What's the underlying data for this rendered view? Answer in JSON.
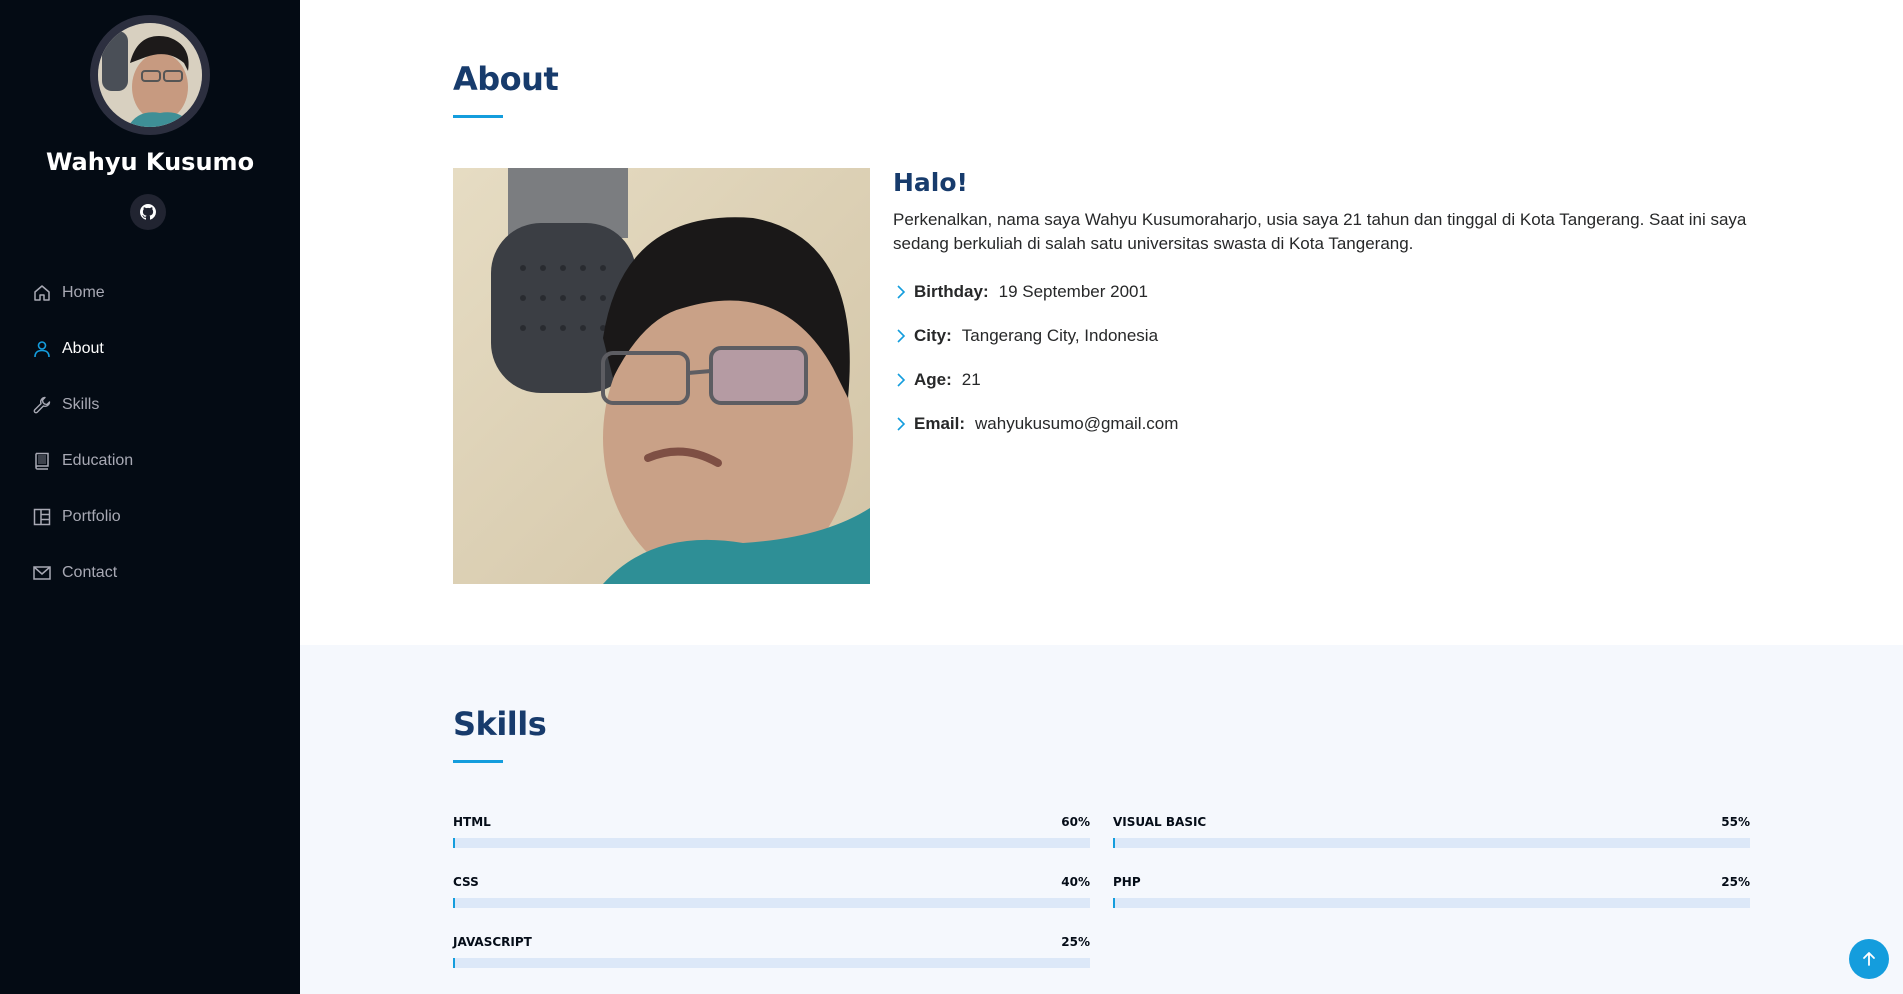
{
  "profile": {
    "name": "Wahyu Kusumo",
    "social_icon": "github-icon"
  },
  "nav": {
    "items": [
      {
        "label": "Home",
        "icon": "house-icon"
      },
      {
        "label": "About",
        "icon": "person-icon",
        "active": true
      },
      {
        "label": "Skills",
        "icon": "wrench-icon"
      },
      {
        "label": "Education",
        "icon": "book-icon"
      },
      {
        "label": "Portfolio",
        "icon": "layout-icon"
      },
      {
        "label": "Contact",
        "icon": "envelope-icon"
      }
    ]
  },
  "about": {
    "title": "About",
    "greeting": "Halo!",
    "intro": "Perkenalkan, nama saya Wahyu Kusumoraharjo, usia saya 21 tahun dan tinggal di Kota Tangerang. Saat ini saya sedang berkuliah di salah satu universitas swasta di Kota Tangerang.",
    "info": [
      {
        "label": "Birthday:",
        "value": "19 September 2001"
      },
      {
        "label": "City:",
        "value": "Tangerang City, Indonesia"
      },
      {
        "label": "Age:",
        "value": "21"
      },
      {
        "label": "Email:",
        "value": "wahyukusumo@gmail.com"
      }
    ]
  },
  "skills": {
    "title": "Skills",
    "items": [
      {
        "name": "HTML",
        "value": "60%",
        "level": 0.6
      },
      {
        "name": "VISUAL BASIC",
        "value": "55%",
        "level": 0.55
      },
      {
        "name": "CSS",
        "value": "40%",
        "level": 0.4
      },
      {
        "name": "PHP",
        "value": "25%",
        "level": 0.25
      },
      {
        "name": "JAVASCRIPT",
        "value": "25%",
        "level": 0.25
      }
    ]
  },
  "colors": {
    "sidebar": "#040b14",
    "accent": "#149ddd",
    "heading": "#173b6c",
    "skills_bg": "#f5f8fd"
  },
  "back_to_top_icon": "arrow-up-icon"
}
